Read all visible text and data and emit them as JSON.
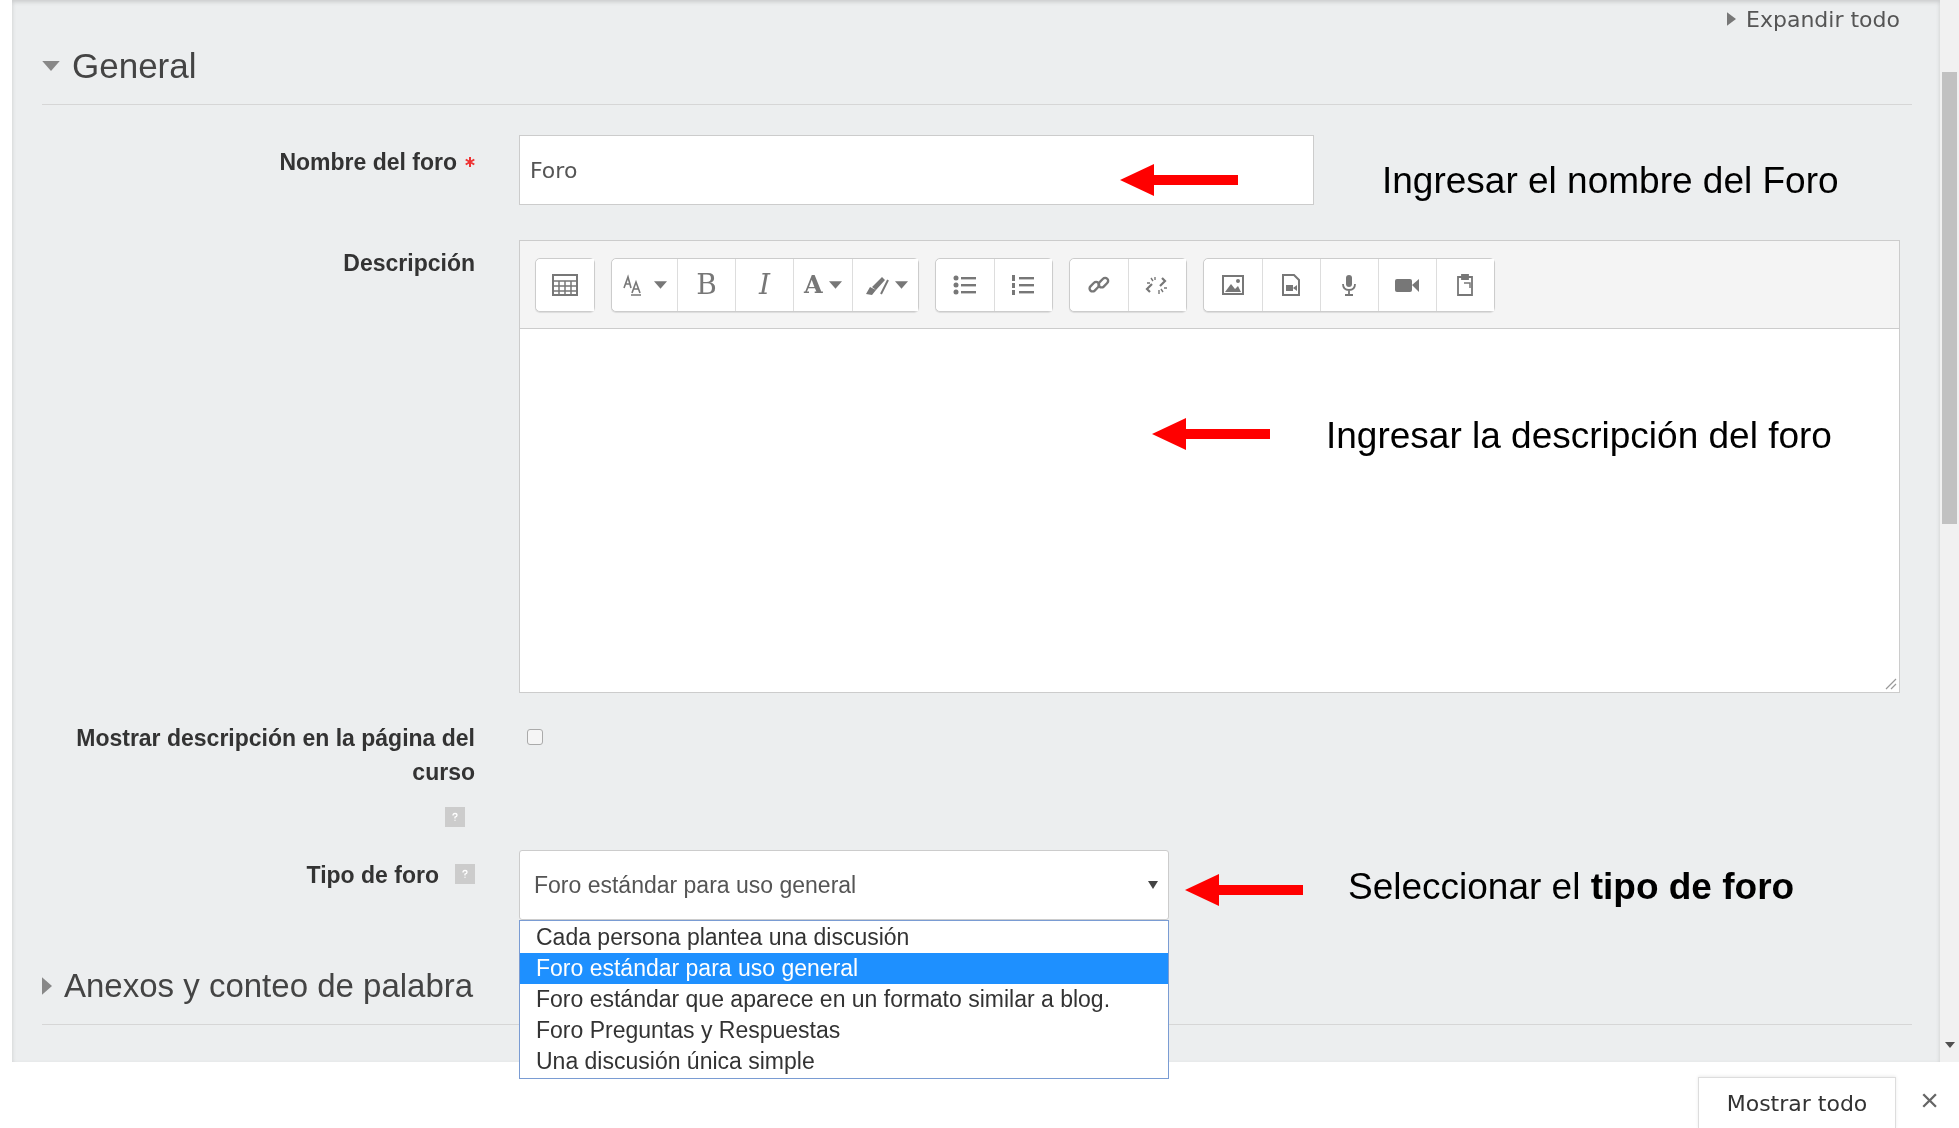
{
  "expand_all": "Expandir todo",
  "sections": [
    {
      "title": "General",
      "expanded": true
    },
    {
      "title": "Anexos y conteo de palabra",
      "expanded": false
    }
  ],
  "name_field": {
    "label": "Nombre del foro",
    "required": true,
    "value": "Foro"
  },
  "description": {
    "label": "Descripción",
    "toolbar": [
      [
        {
          "kind": "table"
        }
      ],
      [
        {
          "kind": "fontsize",
          "caret": true
        },
        {
          "kind": "bold",
          "glyph": "B"
        },
        {
          "kind": "italic",
          "glyph": "I"
        },
        {
          "kind": "color",
          "glyph": "A",
          "caret": true
        },
        {
          "kind": "highlight",
          "caret": true
        }
      ],
      [
        {
          "kind": "bullets"
        },
        {
          "kind": "numbers"
        }
      ],
      [
        {
          "kind": "link"
        },
        {
          "kind": "unlink"
        }
      ],
      [
        {
          "kind": "image"
        },
        {
          "kind": "media"
        },
        {
          "kind": "mic"
        },
        {
          "kind": "video"
        },
        {
          "kind": "paste"
        }
      ]
    ]
  },
  "show_description": {
    "label": "Mostrar descripción en la página del curso",
    "checked": false
  },
  "forum_type": {
    "label": "Tipo de foro",
    "value": "Foro estándar para uso general",
    "options": [
      {
        "label": "Cada persona plantea una discusión",
        "selected": false
      },
      {
        "label": "Foro estándar para uso general",
        "selected": true
      },
      {
        "label": "Foro estándar que aparece en un formato similar a blog.",
        "selected": false
      },
      {
        "label": "Foro Preguntas y Respuestas",
        "selected": false
      },
      {
        "label": "Una discusión única simple",
        "selected": false
      }
    ]
  },
  "annotations": [
    "Ingresar el nombre del Foro",
    "Ingresar la descripción del foro",
    "Seleccionar el **tipo de foro**"
  ],
  "footer": {
    "show_all": "Mostrar todo",
    "close": "×"
  }
}
